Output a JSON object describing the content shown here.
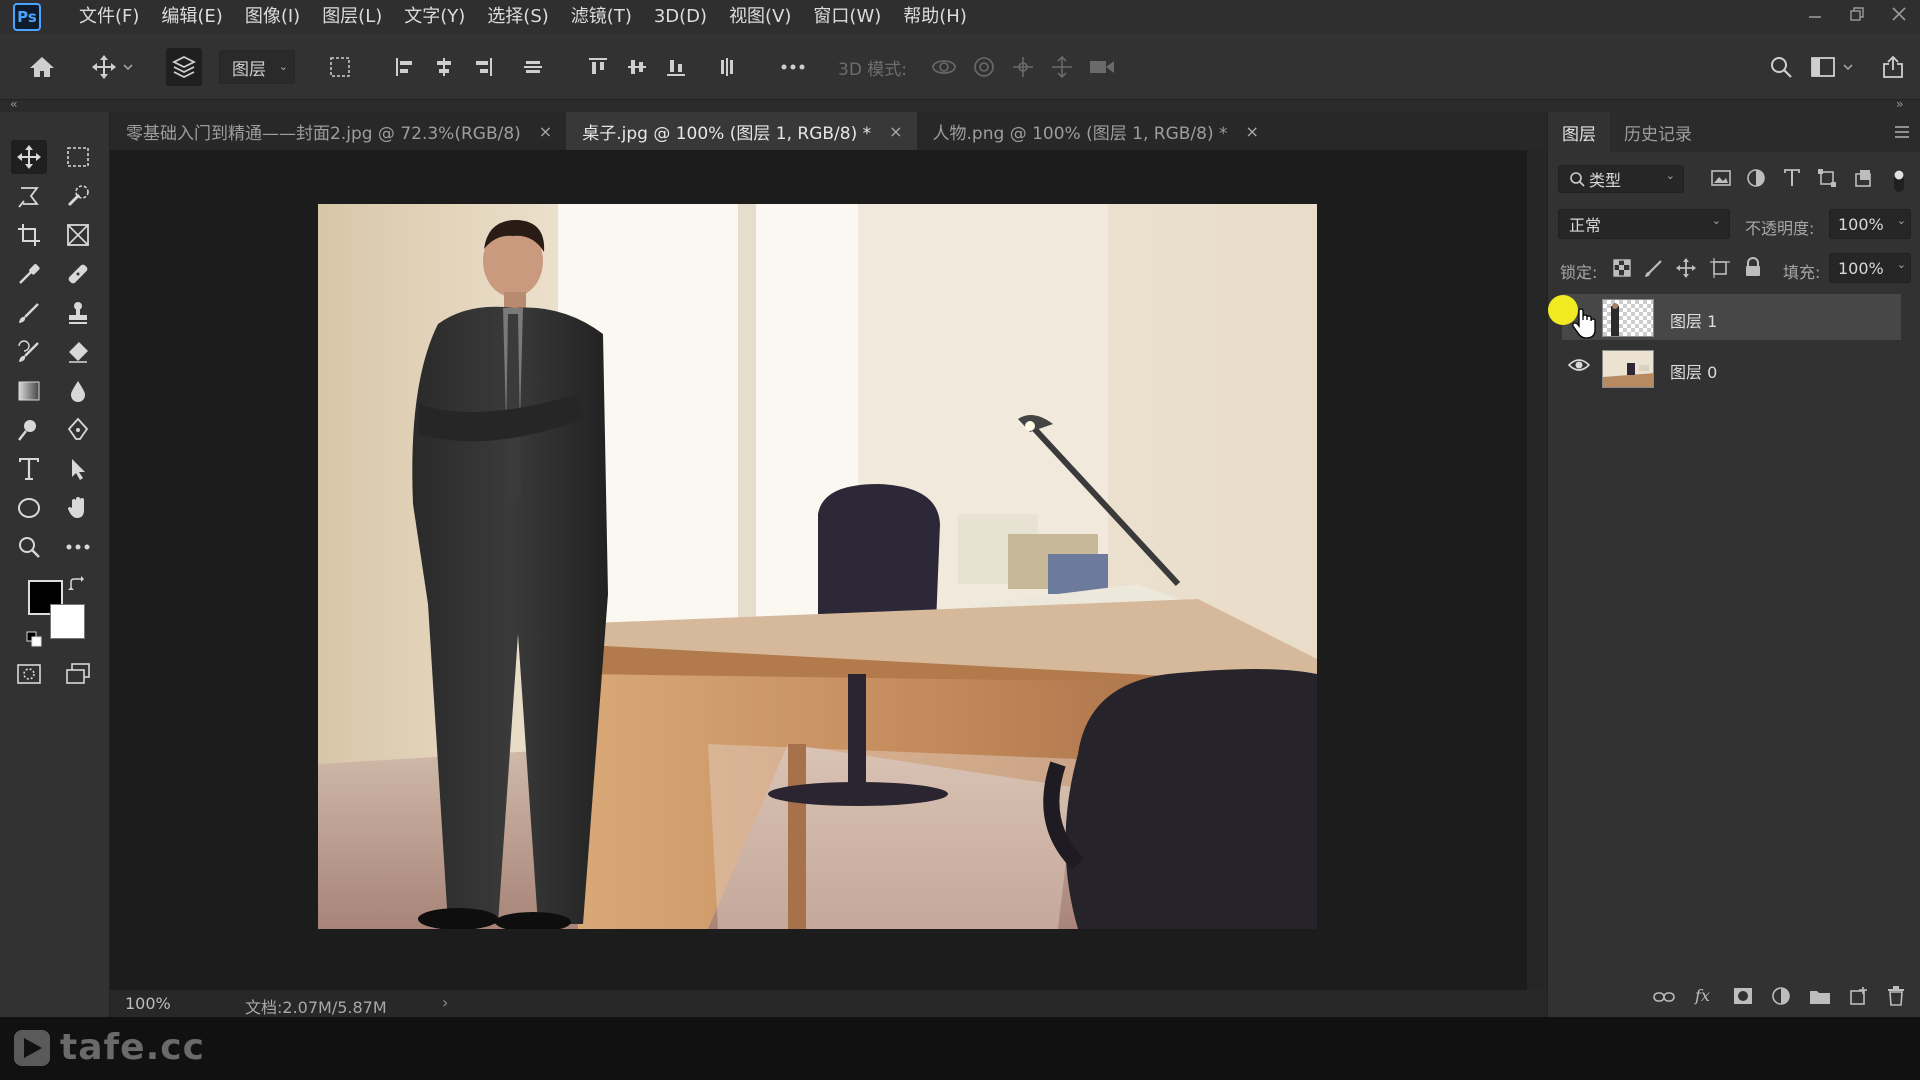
{
  "app": {
    "logo": "Ps"
  },
  "menu": [
    "文件(F)",
    "编辑(E)",
    "图像(I)",
    "图层(L)",
    "文字(Y)",
    "选择(S)",
    "滤镜(T)",
    "3D(D)",
    "视图(V)",
    "窗口(W)",
    "帮助(H)"
  ],
  "options": {
    "auto_select_target": "图层",
    "mode_3d_label": "3D 模式:"
  },
  "tabs": [
    {
      "label": "零基础入门到精通——封面2.jpg @ 72.3%(RGB/8)",
      "close": "×"
    },
    {
      "label": "桌子.jpg @ 100% (图层 1, RGB/8) *",
      "close": "×"
    },
    {
      "label": "人物.png @ 100% (图层 1, RGB/8) *",
      "close": "×"
    }
  ],
  "status": {
    "zoom": "100%",
    "doc": "文档:2.07M/5.87M",
    "arrow": "›"
  },
  "panel": {
    "tabs": [
      "图层",
      "历史记录"
    ],
    "filter_kind": "类型",
    "blend_mode": "正常",
    "opacity_label": "不透明度:",
    "opacity_value": "100%",
    "lock_label": "锁定:",
    "fill_label": "填充:",
    "fill_value": "100%",
    "layers": [
      {
        "name": "图层 1",
        "selected": true,
        "visible": true
      },
      {
        "name": "图层 0",
        "selected": false,
        "visible": true
      }
    ]
  },
  "watermark": "tafe.cc",
  "colors": {
    "foreground": "#000000",
    "background": "#ffffff",
    "accent": "#4aa3ff",
    "cursor_highlight": "#f0ea20"
  }
}
